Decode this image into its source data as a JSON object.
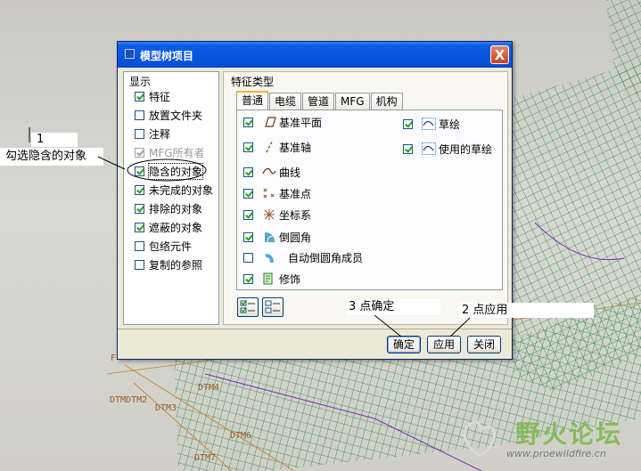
{
  "dialog": {
    "title": "模型树项目",
    "close_label": "X",
    "display_group_title": "显示",
    "display_items": [
      {
        "label": "特征",
        "checked": true,
        "disabled": false
      },
      {
        "label": "放置文件夹",
        "checked": false,
        "disabled": false
      },
      {
        "label": "注释",
        "checked": false,
        "disabled": false
      },
      {
        "label": "MFG所有者",
        "checked": true,
        "disabled": true
      },
      {
        "label": "隐含的对象",
        "checked": true,
        "disabled": false
      },
      {
        "label": "未完成的对象",
        "checked": true,
        "disabled": false
      },
      {
        "label": "排除的对象",
        "checked": true,
        "disabled": false
      },
      {
        "label": "遮蔽的对象",
        "checked": true,
        "disabled": false
      },
      {
        "label": "包络元件",
        "checked": false,
        "disabled": false
      },
      {
        "label": "复制的参照",
        "checked": false,
        "disabled": false
      }
    ],
    "feature_group_title": "特征类型",
    "tabs": [
      "普通",
      "电缆",
      "管道",
      "MFG",
      "机构"
    ],
    "active_tab": "普通",
    "features_left": [
      {
        "label": "基准平面",
        "icon": "datum-plane-icon",
        "checked": true
      },
      {
        "label": "基准轴",
        "icon": "datum-axis-icon",
        "checked": true
      },
      {
        "label": "曲线",
        "icon": "curve-icon",
        "checked": true
      },
      {
        "label": "基准点",
        "icon": "datum-point-icon",
        "checked": true
      },
      {
        "label": "坐标系",
        "icon": "coordinate-system-icon",
        "checked": true
      },
      {
        "label": "倒圆角",
        "icon": "round-icon",
        "checked": true
      },
      {
        "label": "自动倒圆角成员",
        "icon": "auto-round-icon",
        "checked": false
      },
      {
        "label": "修饰",
        "icon": "cosmetic-icon",
        "checked": true
      }
    ],
    "features_right": [
      {
        "label": "草绘",
        "icon": "sketch-icon",
        "checked": true
      },
      {
        "label": "使用的草绘",
        "icon": "used-sketch-icon",
        "checked": true
      }
    ],
    "buttons": {
      "ok": "确定",
      "apply": "应用",
      "close": "关闭"
    }
  },
  "annotations": {
    "step1_number": "1",
    "step1_text": "勾选隐含的对象",
    "step2_text": "2 点应用",
    "step3_text": "3 点确定"
  },
  "background": {
    "datum_labels": [
      "DTM4",
      "DTM3",
      "DTMDTM2",
      "DTM6",
      "DTM7",
      "F"
    ]
  },
  "watermark": {
    "title": "野火论坛",
    "url": "www.proewildfire.cn"
  }
}
